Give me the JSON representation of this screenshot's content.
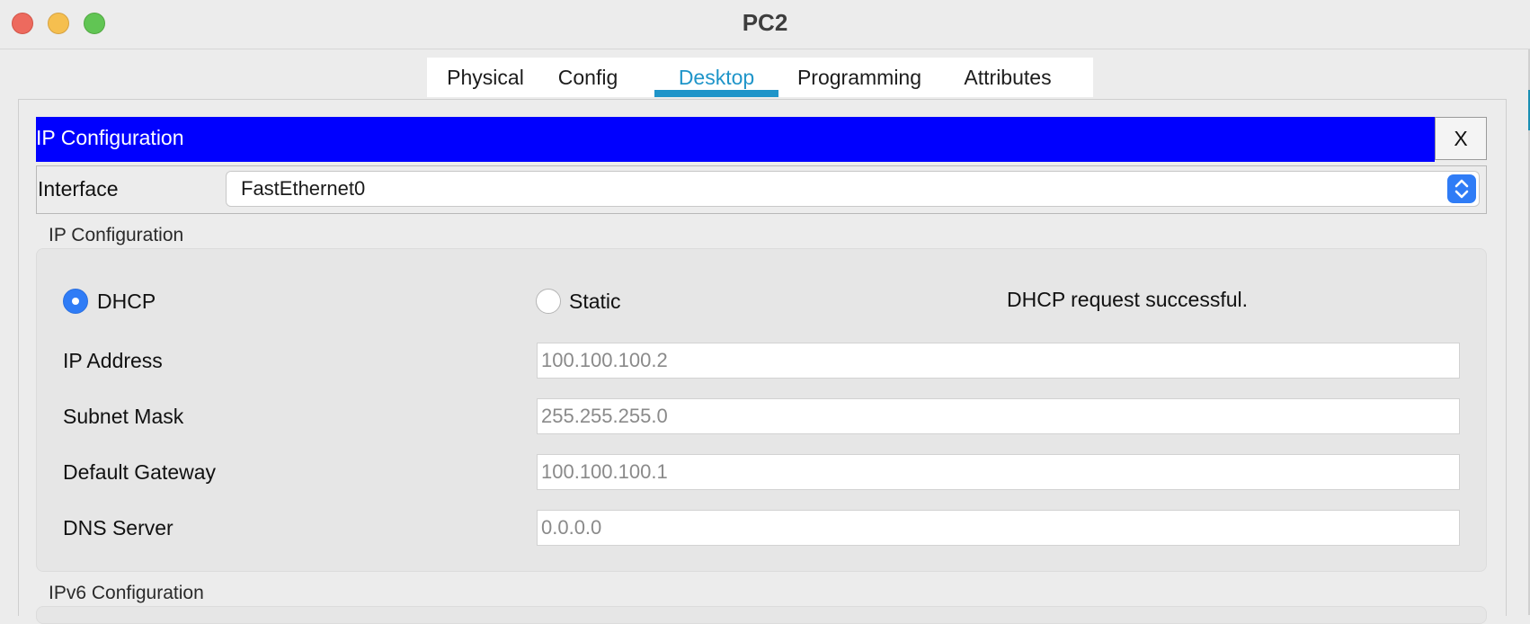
{
  "window": {
    "title": "PC2"
  },
  "tabs": [
    {
      "label": "Physical"
    },
    {
      "label": "Config"
    },
    {
      "label": "Desktop"
    },
    {
      "label": "Programming"
    },
    {
      "label": "Attributes"
    }
  ],
  "active_tab": "Desktop",
  "panel": {
    "title": "IP Configuration",
    "close_label": "X",
    "accent_color": "#0000ff"
  },
  "interface": {
    "label": "Interface",
    "selected": "FastEthernet0"
  },
  "ipv4": {
    "section_label": "IP Configuration",
    "mode_options": [
      {
        "label": "DHCP",
        "selected": true
      },
      {
        "label": "Static",
        "selected": false
      }
    ],
    "status": "DHCP request successful.",
    "fields": [
      {
        "label": "IP Address",
        "value": "100.100.100.2"
      },
      {
        "label": "Subnet Mask",
        "value": "255.255.255.0"
      },
      {
        "label": "Default Gateway",
        "value": "100.100.100.1"
      },
      {
        "label": "DNS Server",
        "value": "0.0.0.0"
      }
    ]
  },
  "ipv6": {
    "section_label": "IPv6 Configuration"
  },
  "colors": {
    "tab_active": "#1f95c9",
    "radio_selected": "#2f7cf6"
  }
}
